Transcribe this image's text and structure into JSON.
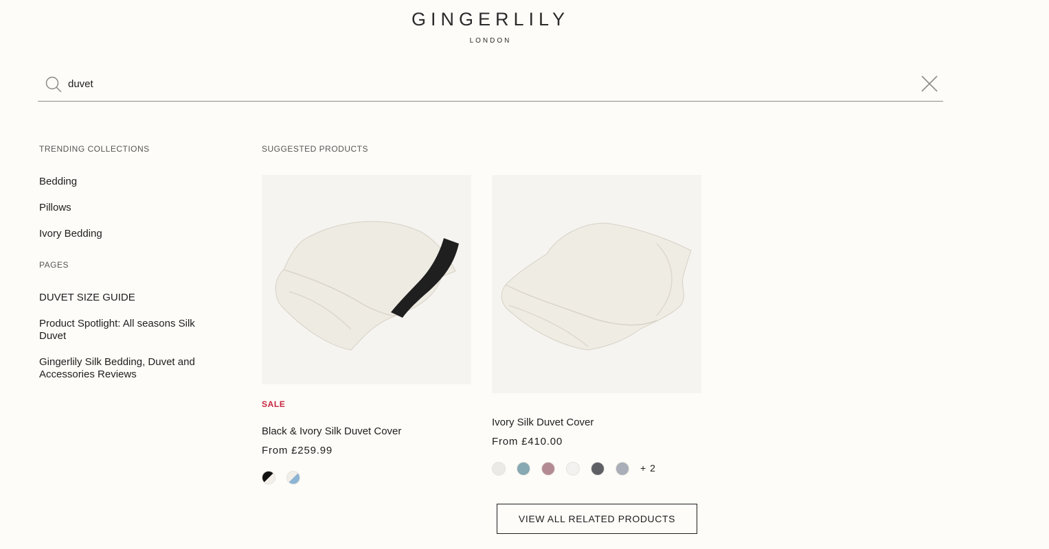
{
  "header": {
    "brand": "GINGERLILY",
    "sub": "LONDON"
  },
  "search": {
    "value": "duvet",
    "icon": "search-icon",
    "close_icon": "close-icon"
  },
  "trending": {
    "heading": "TRENDING COLLECTIONS",
    "items": [
      "Bedding",
      "Pillows",
      "Ivory Bedding"
    ]
  },
  "pages": {
    "heading": "PAGES",
    "items": [
      "DUVET SIZE GUIDE",
      "Product Spotlight: All seasons Silk Duvet",
      "Gingerlily Silk Bedding, Duvet and Accessories Reviews"
    ]
  },
  "suggested": {
    "heading": "SUGGESTED PRODUCTS",
    "products": [
      {
        "badge": "SALE",
        "title": "Black & Ivory Silk Duvet Cover",
        "price": "From £259.99",
        "swatches": [
          "black-ivory",
          "blue-ivory"
        ]
      },
      {
        "badge": "",
        "title": "Ivory Silk Duvet Cover",
        "price": "From £410.00",
        "swatches": [
          "#eceae6",
          "#86a9b3",
          "#b48a92",
          "#f3f2f0",
          "#5f5f66",
          "#a9aeb8"
        ],
        "more": "+ 2"
      }
    ],
    "view_all": "VIEW ALL RELATED PRODUCTS"
  },
  "colors": {
    "background": "#fdfcf8",
    "sale": "#c8253f",
    "text": "#1d1d1d"
  }
}
